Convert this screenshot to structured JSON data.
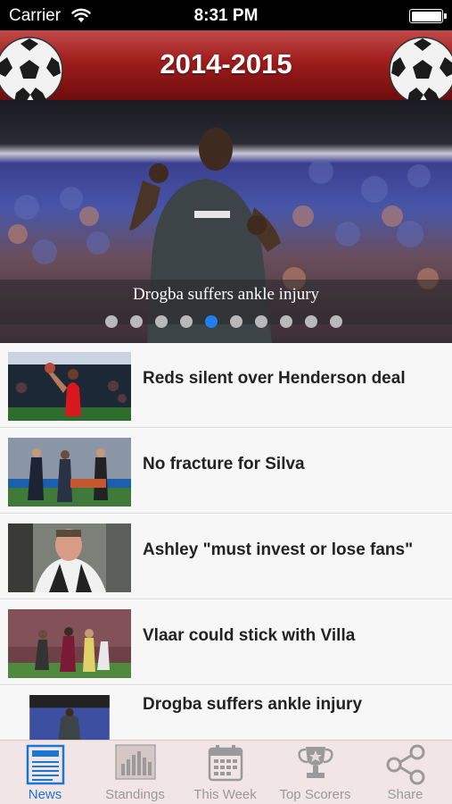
{
  "status_bar": {
    "carrier": "Carrier",
    "time": "8:31 PM"
  },
  "header": {
    "title": "2014-2015"
  },
  "hero": {
    "caption": "Drogba suffers ankle injury",
    "dot_count": 10,
    "active_dot": 4
  },
  "news": [
    {
      "title": "Reds silent over Henderson deal"
    },
    {
      "title": "No fracture for Silva"
    },
    {
      "title": "Ashley \"must invest or lose fans\""
    },
    {
      "title": "Vlaar could stick with Villa"
    },
    {
      "title": "Drogba suffers ankle injury"
    }
  ],
  "tabs": [
    {
      "label": "News",
      "icon": "newspaper-icon",
      "active": true
    },
    {
      "label": "Standings",
      "icon": "bar-chart-icon",
      "active": false
    },
    {
      "label": "This Week",
      "icon": "calendar-icon",
      "active": false
    },
    {
      "label": "Top Scorers",
      "icon": "trophy-icon",
      "active": false
    },
    {
      "label": "Share",
      "icon": "share-icon",
      "active": false
    }
  ],
  "colors": {
    "header": "#9e1c1c",
    "accent": "#1a77d2",
    "tabbar": "#f1e5e5"
  }
}
